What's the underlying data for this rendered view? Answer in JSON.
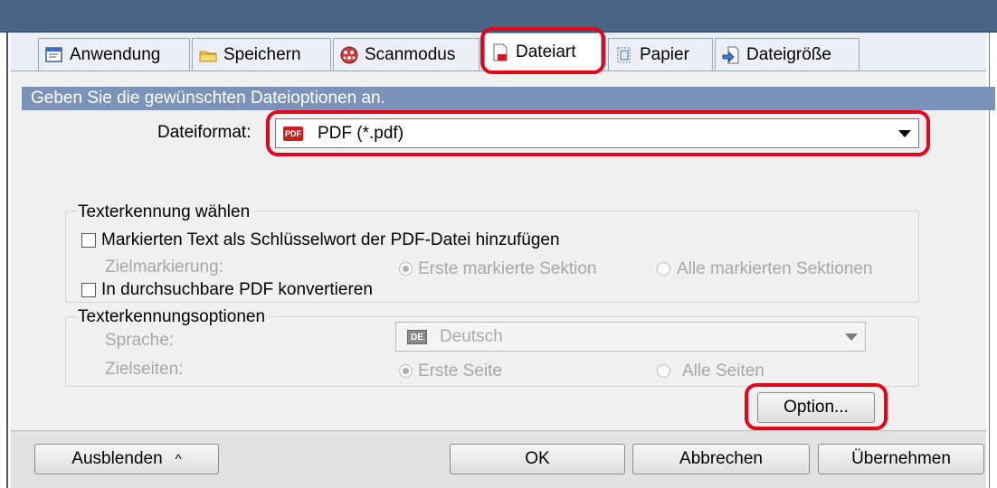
{
  "tabs": [
    {
      "label": "Anwendung",
      "icon": "application-icon"
    },
    {
      "label": "Speichern",
      "icon": "folder-icon"
    },
    {
      "label": "Scanmodus",
      "icon": "scan-mode-icon"
    },
    {
      "label": "Dateiart",
      "icon": "file-type-icon",
      "active": true
    },
    {
      "label": "Papier",
      "icon": "paper-icon"
    },
    {
      "label": "Dateigröße",
      "icon": "file-size-icon"
    }
  ],
  "description": "Geben Sie die gewünschten Dateioptionen an.",
  "file_format": {
    "label": "Dateiformat:",
    "value": "PDF (*.pdf)",
    "badge": "PDF"
  },
  "text_recognition": {
    "title": "Texterkennung wählen",
    "keyword_checkbox": "Markierten Text als Schlüsselwort der PDF-Datei hinzufügen",
    "target_marking_label": "Zielmarkierung:",
    "radio_first_section": "Erste markierte Sektion",
    "radio_all_sections": "Alle markierten Sektionen",
    "searchable_checkbox": "In durchsuchbare PDF konvertieren"
  },
  "ocr_options": {
    "title": "Texterkennungsoptionen",
    "language_label": "Sprache:",
    "language_value": "Deutsch",
    "language_badge": "DE",
    "target_pages_label": "Zielseiten:",
    "radio_first_page": "Erste Seite",
    "radio_all_pages": "Alle Seiten"
  },
  "option_button": "Option...",
  "footer": {
    "hide_button": "Ausblenden",
    "hide_chevron": "^",
    "ok_button": "OK",
    "cancel_button": "Abbrechen",
    "apply_button": "Übernehmen"
  },
  "colors": {
    "highlight": "#e3061b",
    "description_bar": "#7b93b8",
    "title_strip": "#4a6485"
  }
}
